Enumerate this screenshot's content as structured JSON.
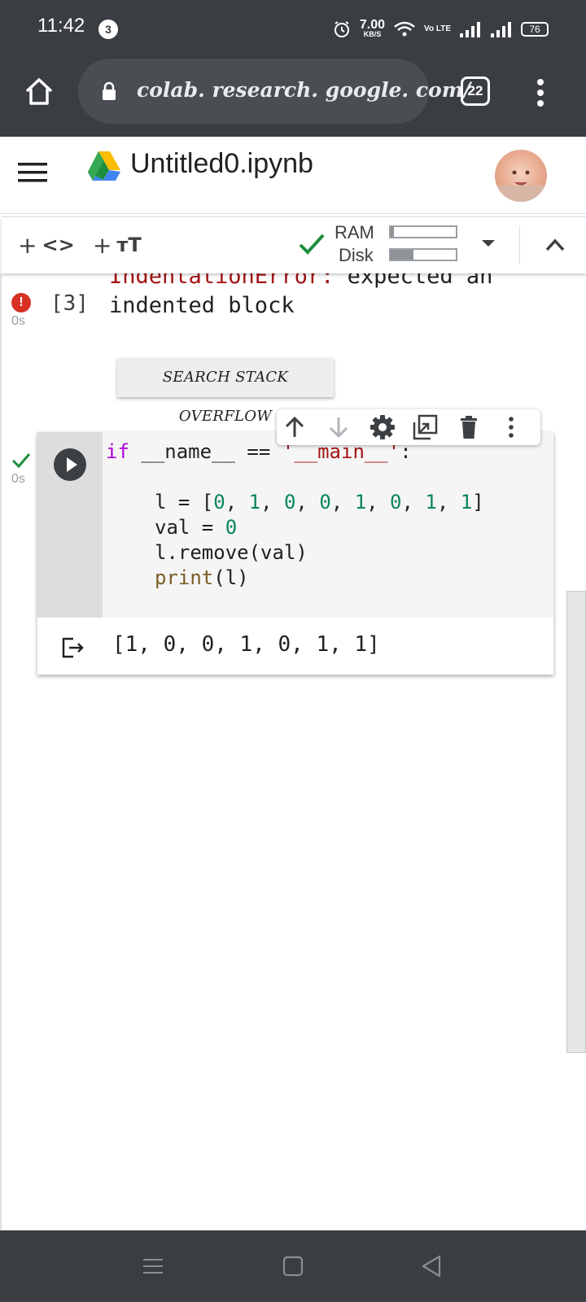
{
  "status_bar": {
    "time": "11:42",
    "notification_count": "3",
    "net_speed": "7.00",
    "net_speed_unit": "KB/S",
    "volte": "Vo LTE",
    "battery": "76"
  },
  "browser": {
    "url": "colab. research. google. com/",
    "tab_count": "22"
  },
  "colab": {
    "notebook_title": "Untitled0.ipynb",
    "toolbar": {
      "add_code_plus": "+",
      "add_code_glyph": "<>",
      "add_text_plus": "+",
      "add_text_glyph": "тT",
      "ram_label": "RAM",
      "disk_label": "Disk",
      "ram_usage_fraction": 0.05,
      "disk_usage_fraction": 0.35
    },
    "error_cell": {
      "exec_time": "0s",
      "exec_count": "[3]",
      "error_type": "IndentationError:",
      "error_rest": " expected an",
      "error_line2": "indented block",
      "search_button": "SEARCH STACK OVERFLOW"
    },
    "code_cell": {
      "exec_time": "0s",
      "code": {
        "l1_kw": "if",
        "l1_mid": " __name__ == ",
        "l1_str": "'__main__'",
        "l1_end": ":",
        "l3_pre": "l = [",
        "l3_vals": [
          "0",
          "1",
          "0",
          "0",
          "1",
          "0",
          "1",
          "1"
        ],
        "l3_sep": ", ",
        "l3_end": "]",
        "l4_pre": "val = ",
        "l4_num": "0",
        "l5": "l.remove(val)",
        "l6_fn": "print",
        "l6_rest": "(l)"
      },
      "output": "[1, 0, 0, 1, 0, 1, 1]"
    }
  },
  "colors": {
    "system_bar": "#3a3d41",
    "check_green": "#1e8e3e",
    "error_red": "#d93025",
    "keyword": "#af00db",
    "string": "#a31515",
    "number": "#098658",
    "function": "#795e26"
  },
  "icons": {
    "browser": [
      "home-icon",
      "lock-icon",
      "tabs-icon",
      "more-vert-icon"
    ],
    "colab": [
      "hamburger-icon",
      "drive-logo-icon",
      "avatar"
    ],
    "cell_toolbar": [
      "move-up-icon",
      "move-down-icon",
      "settings-icon",
      "mirror-cell-icon",
      "delete-icon",
      "more-vert-icon"
    ],
    "nav": [
      "menu-nav-icon",
      "home-nav-icon",
      "back-nav-icon"
    ]
  }
}
